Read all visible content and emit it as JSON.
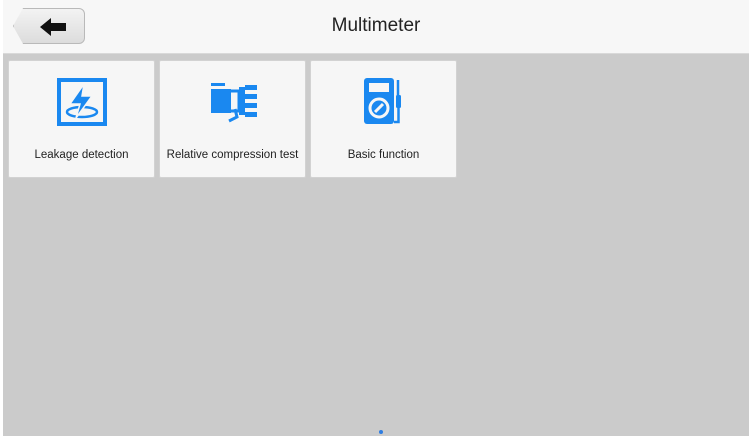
{
  "header": {
    "title": "Multimeter",
    "back_icon": "arrow-left-icon"
  },
  "tiles": [
    {
      "label": "Leakage detection",
      "icon": "lightning-icon"
    },
    {
      "label": "Relative compression test",
      "icon": "compression-test-icon"
    },
    {
      "label": "Basic function",
      "icon": "multimeter-icon"
    }
  ],
  "colors": {
    "accent": "#1a88f0",
    "background": "#cbcbcb",
    "header": "#f7f7f7",
    "tile": "#f6f6f6",
    "page_indicator": "#2e7de1"
  },
  "pager": {
    "current_page": 1,
    "total_pages": 1
  }
}
